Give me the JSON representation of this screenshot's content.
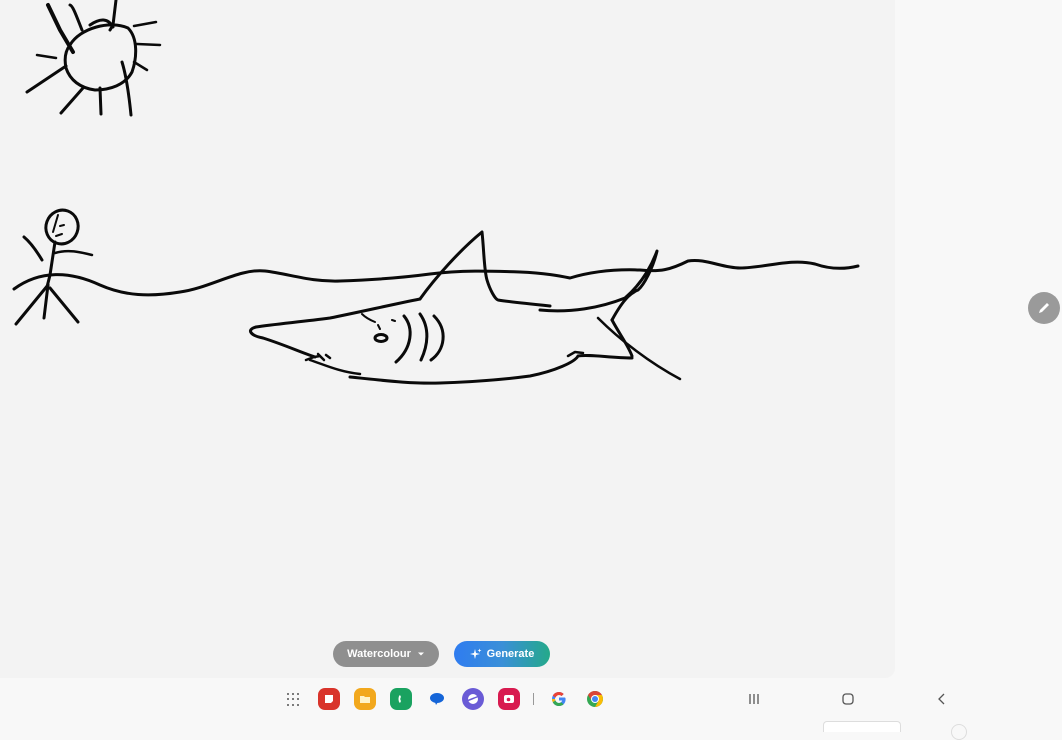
{
  "canvas": {
    "drawing_subjects": [
      "sun",
      "stick figure",
      "sea waves",
      "shark"
    ]
  },
  "toolbar": {
    "style_dropdown_label": "Watercolour",
    "generate_label": "Generate"
  },
  "side": {
    "pen_button_icon": "pencil-icon"
  },
  "taskbar": {
    "apps": [
      {
        "name": "Samsung Notes",
        "icon": "notes-icon",
        "color": "#d9342b"
      },
      {
        "name": "My Files",
        "icon": "folder-icon",
        "color": "#f2a81d"
      },
      {
        "name": "Phone",
        "icon": "phone-icon",
        "color": "#1aa260"
      },
      {
        "name": "Messages",
        "icon": "messages-icon",
        "color": "#1565d8"
      },
      {
        "name": "Samsung Internet",
        "icon": "internet-icon",
        "color": "#6a5bd6"
      },
      {
        "name": "Camera",
        "icon": "camera-icon",
        "color": "#d81b50"
      },
      {
        "name": "Google",
        "icon": "google-icon",
        "color": "#4285f4"
      },
      {
        "name": "Chrome",
        "icon": "chrome-icon",
        "color": "#db4437"
      }
    ],
    "nav": {
      "recents": "recents-icon",
      "home": "home-icon",
      "back": "back-icon"
    }
  },
  "colors": {
    "generate_gradient_start": "#2f7cf0",
    "generate_gradient_end": "#24a98a",
    "dropdown_bg": "#8f8f8f",
    "pen_button_bg": "#9a9a9a"
  }
}
